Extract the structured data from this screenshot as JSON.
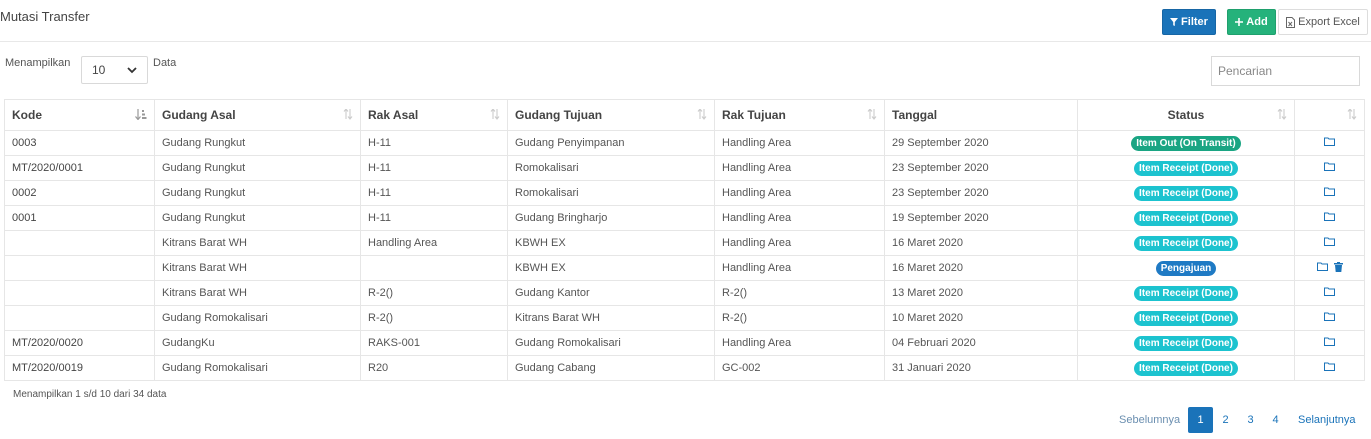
{
  "header": {
    "title": "Mutasi Transfer",
    "filter_label": "Filter",
    "add_label": "Add",
    "export_label": "Export Excel"
  },
  "length_menu": {
    "prefix": "Menampilkan",
    "selected": "10",
    "suffix": "Data"
  },
  "search": {
    "placeholder": "Pencarian"
  },
  "table": {
    "columns": [
      "Kode",
      "Gudang Asal",
      "Rak Asal",
      "Gudang Tujuan",
      "Rak Tujuan",
      "Tanggal",
      "Status",
      ""
    ],
    "rows": [
      {
        "kode": "0003",
        "gudang_asal": "Gudang Rungkut",
        "rak_asal": "H-11",
        "gudang_tujuan": "Gudang Penyimpanan",
        "rak_tujuan": "Handling Area",
        "tanggal": "29 September 2020",
        "status": "Item Out (On Transit)",
        "status_type": "transit",
        "delete": false
      },
      {
        "kode": "MT/2020/0001",
        "gudang_asal": "Gudang Rungkut",
        "rak_asal": "H-11",
        "gudang_tujuan": "Romokalisari",
        "rak_tujuan": "Handling Area",
        "tanggal": "23 September 2020",
        "status": "Item Receipt (Done)",
        "status_type": "done",
        "delete": false
      },
      {
        "kode": "0002",
        "gudang_asal": "Gudang Rungkut",
        "rak_asal": "H-11",
        "gudang_tujuan": "Romokalisari",
        "rak_tujuan": "Handling Area",
        "tanggal": "23 September 2020",
        "status": "Item Receipt (Done)",
        "status_type": "done",
        "delete": false
      },
      {
        "kode": "0001",
        "gudang_asal": "Gudang Rungkut",
        "rak_asal": "H-11",
        "gudang_tujuan": "Gudang Bringharjo",
        "rak_tujuan": "Handling Area",
        "tanggal": "19 September 2020",
        "status": "Item Receipt (Done)",
        "status_type": "done",
        "delete": false
      },
      {
        "kode": "",
        "gudang_asal": "Kitrans Barat WH",
        "rak_asal": "Handling Area",
        "gudang_tujuan": "KBWH EX",
        "rak_tujuan": "Handling Area",
        "tanggal": "16 Maret 2020",
        "status": "Item Receipt (Done)",
        "status_type": "done",
        "delete": false
      },
      {
        "kode": "",
        "gudang_asal": "Kitrans Barat WH",
        "rak_asal": "",
        "gudang_tujuan": "KBWH EX",
        "rak_tujuan": "Handling Area",
        "tanggal": "16 Maret 2020",
        "status": "Pengajuan",
        "status_type": "pengajuan",
        "delete": true
      },
      {
        "kode": "",
        "gudang_asal": "Kitrans Barat WH",
        "rak_asal": "R-2()",
        "gudang_tujuan": "Gudang Kantor",
        "rak_tujuan": "R-2()",
        "tanggal": "13 Maret 2020",
        "status": "Item Receipt (Done)",
        "status_type": "done",
        "delete": false
      },
      {
        "kode": "",
        "gudang_asal": "Gudang Romokalisari",
        "rak_asal": "R-2()",
        "gudang_tujuan": "Kitrans Barat WH",
        "rak_tujuan": "R-2()",
        "tanggal": "10 Maret 2020",
        "status": "Item Receipt (Done)",
        "status_type": "done",
        "delete": false
      },
      {
        "kode": "MT/2020/0020",
        "gudang_asal": "GudangKu",
        "rak_asal": "RAKS-001",
        "gudang_tujuan": "Gudang Romokalisari",
        "rak_tujuan": "Handling Area",
        "tanggal": "04 Februari 2020",
        "status": "Item Receipt (Done)",
        "status_type": "done",
        "delete": false
      },
      {
        "kode": "MT/2020/0019",
        "gudang_asal": "Gudang Romokalisari",
        "rak_asal": "R20",
        "gudang_tujuan": "Gudang Cabang",
        "rak_tujuan": "GC-002",
        "tanggal": "31 Januari 2020",
        "status": "Item Receipt (Done)",
        "status_type": "done",
        "delete": false
      }
    ]
  },
  "status_colors": {
    "transit": "#1aa583",
    "done": "#1cc3cf",
    "pengajuan": "#1f7ac4"
  },
  "footer": {
    "info": "Menampilkan 1 s/d 10 dari 34 data",
    "prev": "Sebelumnya",
    "next": "Selanjutnya",
    "pages": [
      "1",
      "2",
      "3",
      "4"
    ],
    "active_page": "1"
  }
}
